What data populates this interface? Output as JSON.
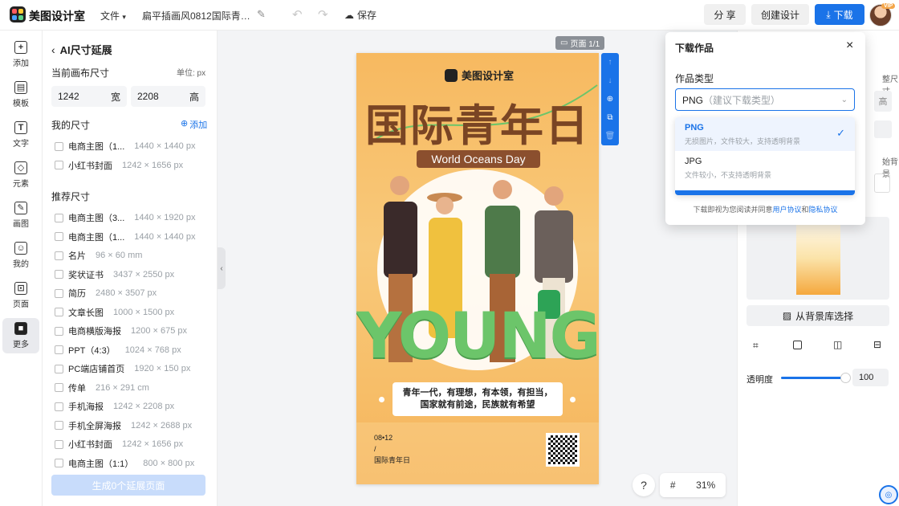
{
  "topbar": {
    "brand": "美图设计室",
    "file_menu": "文件",
    "doc_title": "扁平插画风0812国际青年...",
    "save_label": "保存",
    "share_label": "分 享",
    "create_label": "创建设计",
    "download_label": "下载",
    "vip_badge": "VIP",
    "logo_colors": [
      "#ff5a5f",
      "#ffcc33",
      "#4aa3ff",
      "#5bd38a"
    ]
  },
  "rail": {
    "items": [
      {
        "label": "添加",
        "icon": "plus-square-icon"
      },
      {
        "label": "模板",
        "icon": "template-icon"
      },
      {
        "label": "文字",
        "icon": "text-icon"
      },
      {
        "label": "元素",
        "icon": "shapes-icon"
      },
      {
        "label": "画图",
        "icon": "pen-icon"
      },
      {
        "label": "我的",
        "icon": "user-icon"
      },
      {
        "label": "页面",
        "icon": "page-icon"
      },
      {
        "label": "更多",
        "icon": "cube-icon"
      }
    ]
  },
  "left_panel": {
    "title": "AI尺寸延展",
    "current_size_title": "当前画布尺寸",
    "unit_label": "单位: px",
    "width_value": "1242",
    "width_label": "宽",
    "height_value": "2208",
    "height_label": "高",
    "my_sizes_title": "我的尺寸",
    "add_label": "添加",
    "my_sizes": [
      {
        "name": "电商主图（1...",
        "dims": "1440 × 1440 px"
      },
      {
        "name": "小红书封面",
        "dims": "1242 × 1656 px"
      }
    ],
    "recommended_title": "推荐尺寸",
    "recommended": [
      {
        "name": "电商主图（3...",
        "dims": "1440 × 1920 px"
      },
      {
        "name": "电商主图（1...",
        "dims": "1440 × 1440 px"
      },
      {
        "name": "名片",
        "dims": "96 × 60 mm"
      },
      {
        "name": "奖状证书",
        "dims": "3437 × 2550 px"
      },
      {
        "name": "简历",
        "dims": "2480 × 3507 px"
      },
      {
        "name": "文章长图",
        "dims": "1000 × 1500 px"
      },
      {
        "name": "电商横版海报",
        "dims": "1200 × 675 px"
      },
      {
        "name": "PPT（4:3）",
        "dims": "1024 × 768 px"
      },
      {
        "name": "PC端店铺首页",
        "dims": "1920 × 150 px"
      },
      {
        "name": "传单",
        "dims": "216 × 291 cm"
      },
      {
        "name": "手机海报",
        "dims": "1242 × 2208 px"
      },
      {
        "name": "手机全屏海报",
        "dims": "1242 × 2688 px"
      },
      {
        "name": "小红书封面",
        "dims": "1242 × 1656 px"
      },
      {
        "name": "电商主图（1:1）",
        "dims": "800 × 800 px"
      }
    ],
    "generate_label": "生成0个延展页面"
  },
  "canvas": {
    "page_label": "页面 1/1",
    "poster": {
      "brand": "美图设计室",
      "title": "国际青年日",
      "subtitle": "World Oceans Day",
      "big_word": "YOUNG",
      "quote_line1": "青年一代，有理想，有本领，有担当，",
      "quote_line2": "国家就有前途，民族就有希望",
      "date_line1": "08•12",
      "date_line2": "/",
      "date_line3": "国际青年日"
    },
    "help_label": "?",
    "grid_icon": "#",
    "zoom": "31%"
  },
  "right_panel": {
    "partial_label1": "整尺寸",
    "partial_label2": "高",
    "partial_label3": "始背景",
    "bg_library_label": "从背景库选择",
    "opacity_label": "透明度",
    "opacity_value": "100"
  },
  "download_popup": {
    "title": "下载作品",
    "type_label": "作品类型",
    "select_value": "PNG",
    "select_hint": "（建议下载类型）",
    "options": [
      {
        "name": "PNG",
        "desc": "无损图片，文件较大，支持透明背景",
        "selected": true
      },
      {
        "name": "JPG",
        "desc": "文件较小，不支持透明背景",
        "selected": false
      }
    ],
    "footer_prefix": "下载即视为您阅读并同意",
    "footer_link1": "用户协议",
    "footer_and": "和",
    "footer_link2": "隐私协议"
  }
}
